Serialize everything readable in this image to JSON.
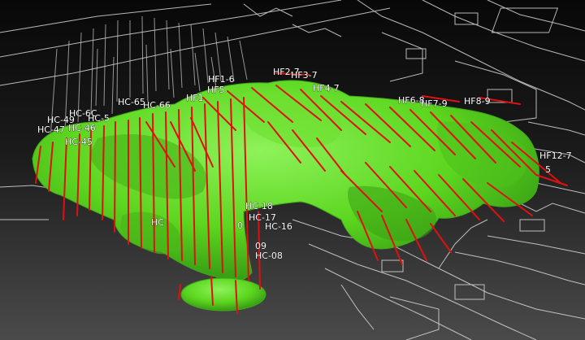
{
  "scene": {
    "colors": {
      "background_top": "#080808",
      "background_bottom": "#4a4a4a",
      "floor_plan_lines": "#d8d8d8",
      "orebody": "#5cd61f",
      "orebody_shadow": "#2f8f12",
      "drillhole_trace": "#e01010",
      "drillhole_collar": "#cfcfcf",
      "label_text": "#ffffff"
    },
    "labels": [
      "HF2-7",
      "HF3-7",
      "HF1-6",
      "HF5",
      "HF4-7",
      "HF6-8",
      "HF7-9",
      "HF8-9",
      "HF12-7",
      "5",
      "HF1",
      "HC-65",
      "HC-66",
      "HC-6C",
      "HC-5",
      "HC-49",
      "HC-47",
      "HC-46",
      "HC-45",
      "HC-18",
      "HC-17",
      "HC-16",
      "HC-08",
      "09",
      "0",
      "HC"
    ]
  }
}
